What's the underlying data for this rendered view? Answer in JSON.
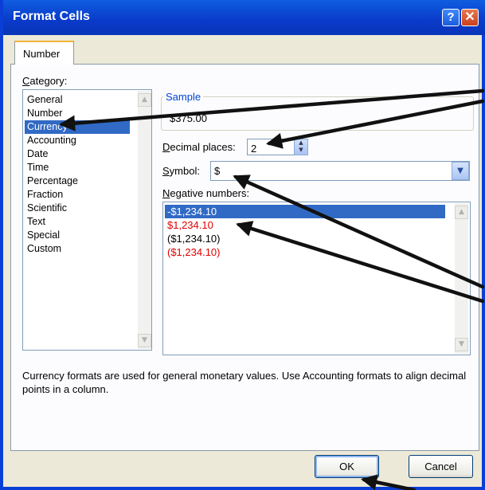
{
  "window": {
    "title": "Format Cells",
    "help_label": "?",
    "close_label": "✕"
  },
  "tabs": [
    {
      "label": "Number"
    }
  ],
  "category": {
    "label_ul": "C",
    "label_rest": "ategory:",
    "items": [
      "General",
      "Number",
      "Currency",
      "Accounting",
      "Date",
      "Time",
      "Percentage",
      "Fraction",
      "Scientific",
      "Text",
      "Special",
      "Custom"
    ],
    "selected": "Currency"
  },
  "sample": {
    "title": "Sample",
    "value": "$375.00"
  },
  "decimal_places": {
    "label_ul": "D",
    "label_rest": "ecimal places:",
    "value": "2"
  },
  "symbol": {
    "label_ul": "S",
    "label_rest": "ymbol:",
    "value": "$"
  },
  "negative_numbers": {
    "label_ul": "N",
    "label_rest": "egative numbers:",
    "items": [
      {
        "text": "-$1,234.10",
        "color": "#000000",
        "selected": true
      },
      {
        "text": "$1,234.10",
        "color": "#e00000",
        "selected": false
      },
      {
        "text": "($1,234.10)",
        "color": "#000000",
        "selected": false
      },
      {
        "text": "($1,234.10)",
        "color": "#e00000",
        "selected": false
      }
    ]
  },
  "description": "Currency formats are used for general monetary values.  Use Accounting formats to align decimal points in a column.",
  "buttons": {
    "ok": "OK",
    "cancel": "Cancel"
  },
  "icons": [
    "help-icon",
    "close-icon",
    "scroll-up-icon",
    "scroll-down-icon",
    "spin-up-icon",
    "spin-down-icon",
    "chevron-down-icon"
  ],
  "colors": {
    "titlebar": "#0a3ac9",
    "selection": "#316ac5",
    "negative_red": "#e00000",
    "group_title": "#0046d5"
  }
}
